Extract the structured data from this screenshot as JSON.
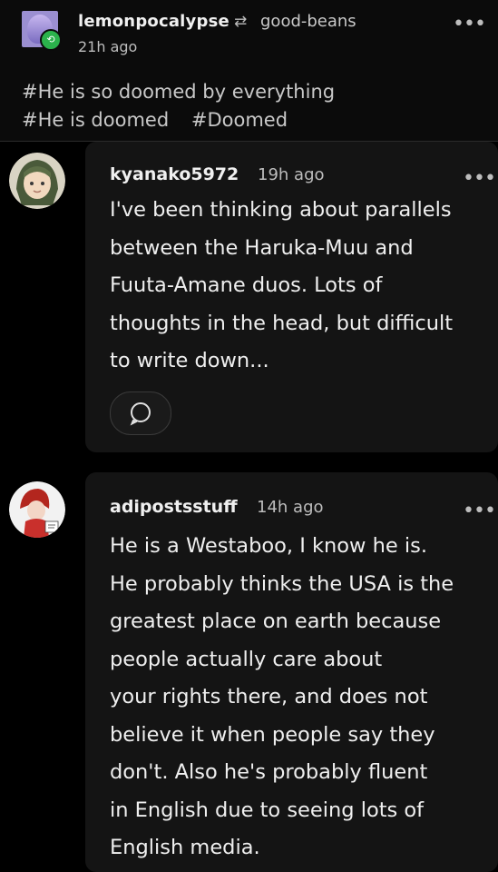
{
  "post": {
    "username": "lemonpocalypse",
    "reblog_icon": "reblog-icon",
    "reblogged_from": "good-beans",
    "time": "21h ago",
    "more_icon": "more-dots-icon",
    "tags": [
      "#He is so doomed by everything",
      "#He is doomed",
      "#Doomed"
    ]
  },
  "replies": [
    {
      "username": "kyanako5972",
      "time": "19h ago",
      "text": "I've been thinking about parallels\nbetween the Haruka-Muu and\nFuuta-Amane duos. Lots of\nthoughts in the head, but difficult\nto write down...",
      "reply_icon": "reply-bubble-icon"
    },
    {
      "username": "adipostsstuff",
      "time": "14h ago",
      "text": "He is a Westaboo, I know he is.\nHe probably thinks the USA is the\ngreatest place on earth because\npeople actually care about\nyour rights there, and does not\nbelieve it when people say they\ndon't. Also he's probably fluent\nin English due to seeing lots of\nEnglish media."
    }
  ],
  "colors": {
    "background": "#000000",
    "reply_card": "#141414",
    "reblog_badge": "#2bb24c"
  }
}
